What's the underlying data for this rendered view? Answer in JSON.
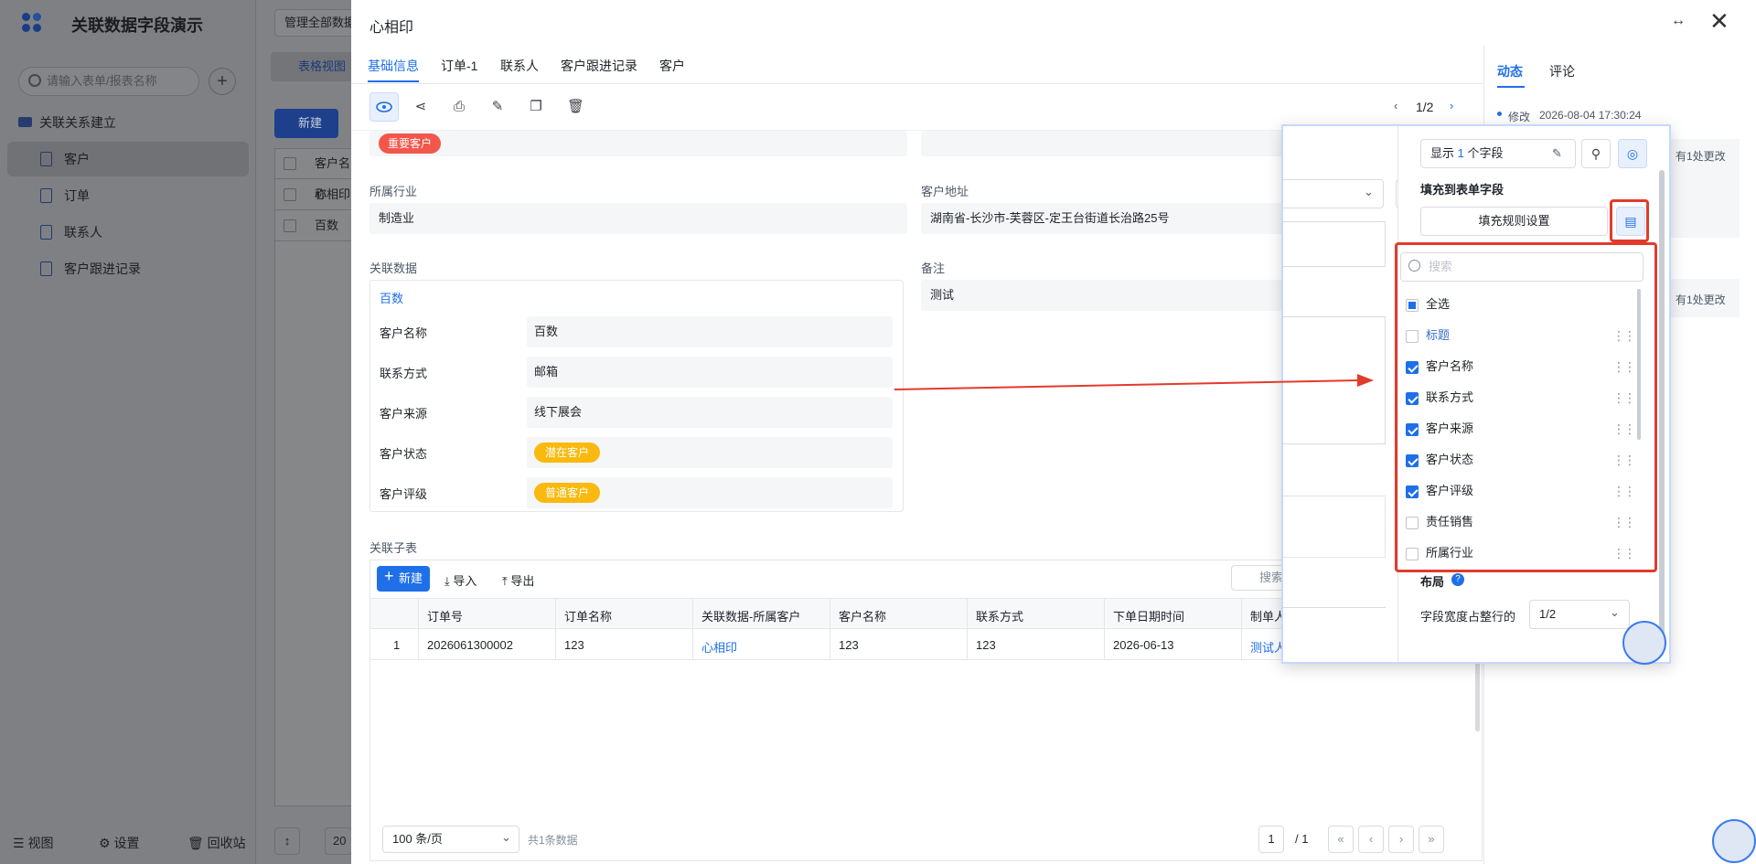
{
  "app": {
    "title": "关联数据字段演示",
    "search_placeholder": "请输入表单/报表名称",
    "group": "关联关系建立",
    "nav": [
      "客户",
      "订单",
      "联系人",
      "客户跟进记录"
    ],
    "footer": {
      "view": "视图",
      "settings": "设置",
      "recycle": "回收站"
    },
    "manage_btn": "管理全部数据",
    "view_tab": "表格视图",
    "new_btn": "新建",
    "rows": [
      "客户名称",
      "心相印",
      "百数"
    ],
    "page_size_small": "20"
  },
  "drawer": {
    "title": "心相印",
    "tabs": [
      "基础信息",
      "订单-1",
      "联系人",
      "客户跟进记录",
      "客户"
    ],
    "pager": "1/2",
    "tag_important": "重要客户",
    "industry_label": "所属行业",
    "industry_value": "制造业",
    "address_label": "客户地址",
    "address_value": "湖南省-长沙市-芙蓉区-定王台街道长治路25号",
    "related_label": "关联数据",
    "related_title": "百数",
    "related_rows": [
      {
        "label": "客户名称",
        "value": "百数"
      },
      {
        "label": "联系方式",
        "value": "邮箱"
      },
      {
        "label": "客户来源",
        "value": "线下展会"
      },
      {
        "label": "客户状态",
        "value": "潜在客户"
      },
      {
        "label": "客户评级",
        "value": "普通客户"
      }
    ],
    "remark_label": "备注",
    "remark_value": "测试",
    "subtable_label": "关联子表",
    "sub_new": "新建",
    "sub_import": "导入",
    "sub_export": "导出",
    "sub_search": "搜索",
    "grid_headers": [
      "订单号",
      "订单名称",
      "关联数据-所属客户",
      "客户名称",
      "联系方式",
      "下单日期时间",
      "制单人"
    ],
    "grid_row": {
      "index": "1",
      "order_no": "2026061300002",
      "order_name": "123",
      "customer": "心相印",
      "customer_name": "123",
      "contact": "123",
      "date": "2026-06-13",
      "maker": "测试人"
    },
    "page_size": "100 条/页",
    "total": "共1条数据",
    "page_current": "1",
    "page_total": "/ 1"
  },
  "activity": {
    "tabs": [
      "动态",
      "评论"
    ],
    "entry_action": "修改",
    "entry_time": "2026-08-04 17:30:24",
    "change_1": "有1处更改",
    "change_2": "有1处更改"
  },
  "popup": {
    "show_prefix": "显示 ",
    "show_count": "1",
    "show_suffix": " 个字段",
    "fill_title": "填充到表单字段",
    "fill_btn": "填充规则设置",
    "search_placeholder": "搜索",
    "items": [
      {
        "label": "全选",
        "state": "partial",
        "drag": false
      },
      {
        "label": "标题",
        "state": "off",
        "drag": true,
        "link": true
      },
      {
        "label": "客户名称",
        "state": "on",
        "drag": true
      },
      {
        "label": "联系方式",
        "state": "on",
        "drag": true
      },
      {
        "label": "客户来源",
        "state": "on",
        "drag": true
      },
      {
        "label": "客户状态",
        "state": "on",
        "drag": true
      },
      {
        "label": "客户评级",
        "state": "on",
        "drag": true
      },
      {
        "label": "责任销售",
        "state": "off",
        "drag": true
      },
      {
        "label": "所属行业",
        "state": "off",
        "drag": true
      }
    ],
    "layout_title": "布局",
    "width_label": "字段宽度占整行的",
    "width_value": "1/2"
  },
  "colors": {
    "accent": "#1e6fe8",
    "annotation": "#e23b2c",
    "tag_red": "#f3564a",
    "tag_yellow": "#f9b90f"
  }
}
